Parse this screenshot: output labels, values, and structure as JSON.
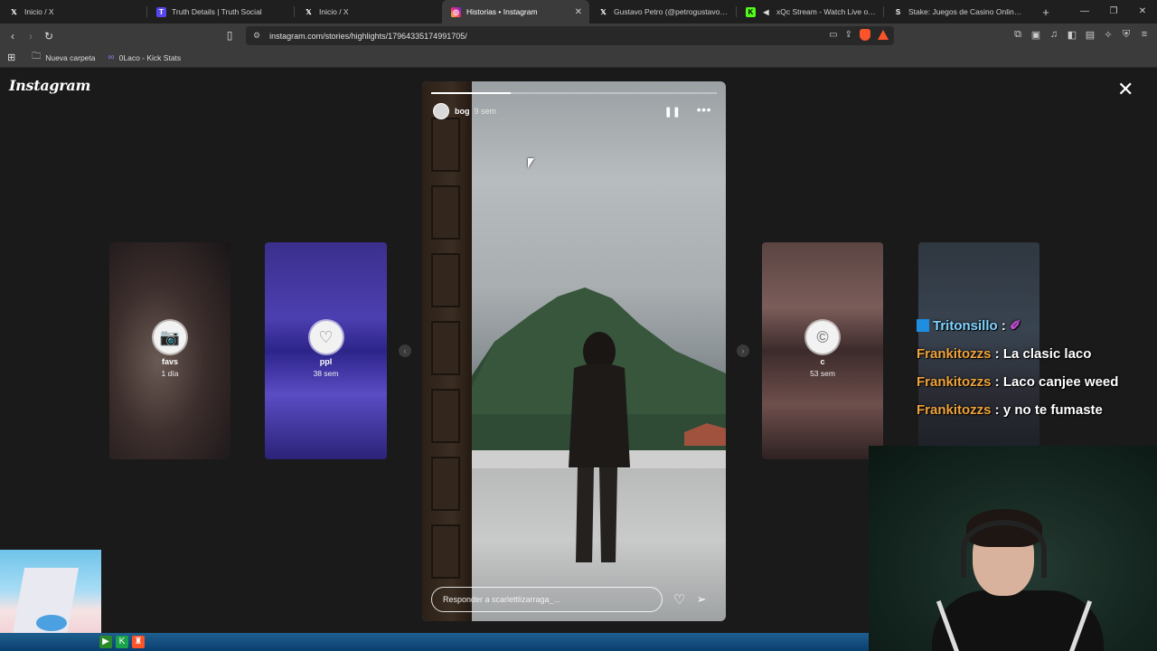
{
  "browser": {
    "tabs": [
      {
        "label": "Inicio / X",
        "icon": "x-logo-icon"
      },
      {
        "label": "Truth Details | Truth Social",
        "icon": "truth-social-icon"
      },
      {
        "label": "Inicio / X",
        "icon": "x-logo-icon"
      },
      {
        "label": "Historias • Instagram",
        "icon": "instagram-icon",
        "active": true
      },
      {
        "label": "Gustavo Petro (@petrogustavo) / X",
        "icon": "x-logo-icon"
      },
      {
        "label": "xQc Stream - Watch Live on Kick",
        "icon": "kick-icon"
      },
      {
        "label": "Stake: Juegos de Casino Online y Ap",
        "icon": "stake-icon"
      }
    ],
    "url": "instagram.com/stories/highlights/17964335174991705/",
    "bookmarks": [
      {
        "label": "Nueva carpeta",
        "icon": "folder-icon"
      },
      {
        "label": "0Laco - Kick Stats",
        "icon": "kick-stats-icon"
      }
    ]
  },
  "instagram": {
    "logo": "Instagram",
    "story": {
      "username": "bog",
      "age": "9 sem",
      "progress": 0.28,
      "reply_placeholder": "Responder a scarlettlizarraga_..."
    },
    "highlights": [
      {
        "name": "favs",
        "age": "1 día",
        "icon": "camera-icon"
      },
      {
        "name": "ppl",
        "age": "38 sem",
        "icon": "heart-icon"
      },
      {
        "name": "c",
        "age": "53 sem",
        "icon": "copyright-c-icon"
      }
    ]
  },
  "stream_overlay": {
    "chat": [
      {
        "user": "Tritonsillo",
        "message": ""
      },
      {
        "user": "Frankitozzs",
        "message": "La clasic laco"
      },
      {
        "user": "Frankitozzs",
        "message": "Laco canjee weed"
      },
      {
        "user": "Frankitozzs",
        "message": "y no te fumaste"
      }
    ]
  },
  "colors": {
    "background": "#1a1a1a",
    "chat_username": "#f0a33a",
    "chat_username_alt": "#7fd4ff"
  }
}
